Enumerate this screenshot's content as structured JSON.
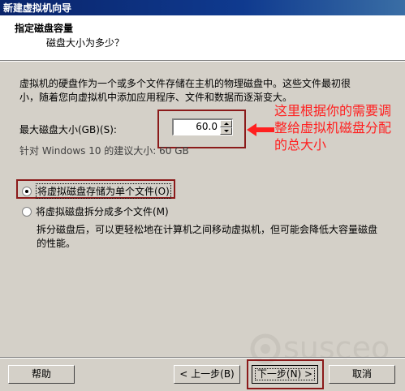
{
  "window": {
    "title": "新建虚拟机向导"
  },
  "header": {
    "title": "指定磁盘容量",
    "subtitle": "磁盘大小为多少？"
  },
  "description": "虚拟机的硬盘作为一个或多个文件存储在主机的物理磁盘中。这些文件最初很小，随着您向虚拟机中添加应用程序、文件和数据而逐渐变大。",
  "disk_size": {
    "label": "最大磁盘大小(GB)(S):",
    "value": "60.0"
  },
  "recommendation": "针对 Windows 10 的建议大小: 60 GB",
  "annotation": {
    "text": "这里根据你的需要调整给虚拟机磁盘分配的总大小",
    "color": "#ff2020"
  },
  "options": {
    "single": {
      "label": "将虚拟磁盘存储为单个文件(O)",
      "selected": true
    },
    "split": {
      "label": "将虚拟磁盘拆分成多个文件(M)",
      "selected": false
    },
    "split_description": "拆分磁盘后，可以更轻松地在计算机之间移动虚拟机，但可能会降低大容量磁盘的性能。"
  },
  "watermark": {
    "text": "susceo"
  },
  "buttons": {
    "help": "帮助",
    "back": "< 上一步(B)",
    "next": "下一步(N) >",
    "cancel": "取消"
  }
}
